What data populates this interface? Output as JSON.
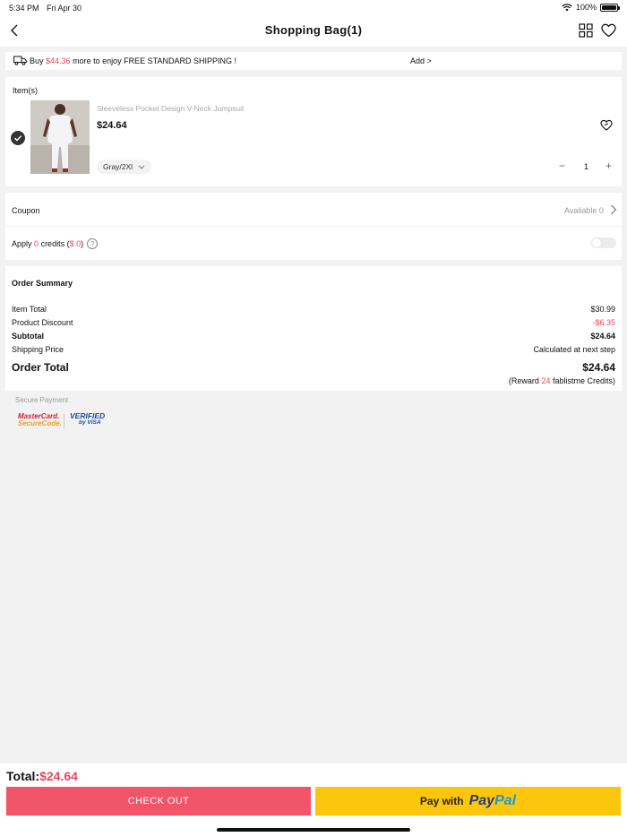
{
  "status_bar": {
    "time": "5:34 PM",
    "date": "Fri Apr 30",
    "battery": "100%"
  },
  "header": {
    "title": "Shopping Bag(1)"
  },
  "shipping_banner": {
    "prefix": "Buy",
    "amount": "$44.36",
    "suffix": "more to enjoy FREE STANDARD SHIPPING !",
    "add_label": "Add >"
  },
  "items": {
    "header": "Item(s)",
    "list": [
      {
        "name": "Sleeveless Pocket Design V-Neck Jumpsuit",
        "price": "$24.64",
        "variant": "Gray/2Xl",
        "quantity": "1",
        "minus": "−",
        "plus": "+"
      }
    ]
  },
  "coupon": {
    "label": "Coupon",
    "available": "Avaliable 0"
  },
  "credits": {
    "apply": "Apply",
    "count": "0",
    "mid": "credits (",
    "amount": "$ 0",
    "close": ")",
    "help": "?"
  },
  "order_summary": {
    "title": "Order Summary",
    "item_total_label": "Item Total",
    "item_total": "$30.99",
    "discount_label": "Product Discount",
    "discount": "-$6.35",
    "subtotal_label": "Subtotal",
    "subtotal": "$24.64",
    "shipping_label": "Shipping Price",
    "shipping": "Calculated at next step",
    "order_total_label": "Order Total",
    "order_total": "$24.64",
    "reward_prefix": "(Reward",
    "reward_count": "24",
    "reward_suffix": "fablistme Credits)"
  },
  "secure_payment": {
    "label": "Secure Payment",
    "mastercard_line1": "MasterCard.",
    "mastercard_line2": "SecureCode.",
    "visa_line1": "VERIFIED",
    "visa_line2": "by VISA"
  },
  "footer": {
    "total_label": "Total:",
    "total_amount": "$24.64",
    "checkout_label": "CHECK OUT",
    "paypal_label": "Pay with",
    "paypal_brand_1": "Pay",
    "paypal_brand_2": "Pal"
  },
  "colors": {
    "accent": "#f25469",
    "price_red": "#e9475f",
    "paypal_yellow": "#fbc60b"
  }
}
